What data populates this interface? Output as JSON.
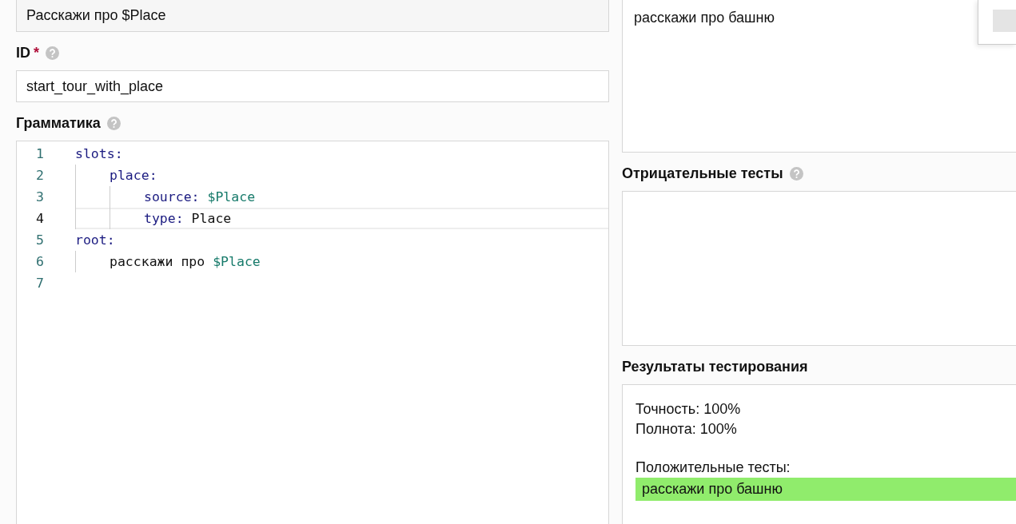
{
  "left": {
    "name_field": {
      "value": "Расскажи про $Place"
    },
    "id": {
      "label": "ID",
      "required_mark": "*",
      "value": "start_tour_with_place"
    },
    "grammar": {
      "label": "Грамматика",
      "line_numbers": [
        {
          "number": "1",
          "active": false
        },
        {
          "number": "2",
          "active": false
        },
        {
          "number": "3",
          "active": false
        },
        {
          "number": "4",
          "active": true
        },
        {
          "number": "5",
          "active": false
        },
        {
          "number": "6",
          "active": false
        },
        {
          "number": "7",
          "active": false
        }
      ],
      "code": [
        {
          "tokens": [
            {
              "text": "slots:",
              "kind": "key"
            }
          ],
          "children": [
            {
              "tokens": [
                {
                  "text": "place:",
                  "kind": "key"
                }
              ],
              "children": [
                {
                  "tokens": [
                    {
                      "text": "source:",
                      "kind": "key"
                    },
                    {
                      "text": "$Place",
                      "kind": "var"
                    }
                  ]
                },
                {
                  "tokens": [
                    {
                      "text": "type:",
                      "kind": "key"
                    },
                    {
                      "text": "Place",
                      "kind": "plain"
                    }
                  ]
                }
              ]
            }
          ]
        },
        {
          "tokens": [
            {
              "text": "root:",
              "kind": "key"
            }
          ],
          "children": [
            {
              "tokens": [
                {
                  "text": "расскажи про",
                  "kind": "plain"
                },
                {
                  "text": "$Place",
                  "kind": "var"
                }
              ]
            }
          ]
        }
      ]
    }
  },
  "right": {
    "positive_tests": {
      "value": "расскажи про башню"
    },
    "negative_tests": {
      "label": "Отрицательные тесты"
    },
    "results": {
      "label": "Результаты тестирования",
      "precision": "Точность: 100%",
      "recall": "Полнота: 100%",
      "positive_label": "Положительные тесты:",
      "passed": [
        {
          "text": "расскажи про башню",
          "passed": true
        }
      ]
    }
  }
}
